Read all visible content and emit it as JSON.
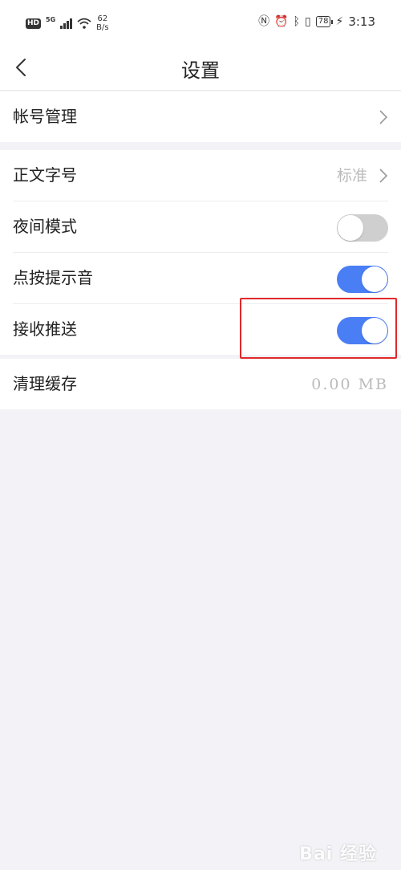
{
  "status_bar": {
    "network_badge": "HD",
    "signal_label": "5G",
    "speed_value": "62",
    "speed_unit": "B/s",
    "battery": "78",
    "time": "3:13"
  },
  "header": {
    "title": "设置"
  },
  "settings": {
    "account": {
      "label": "帐号管理"
    },
    "font_size": {
      "label": "正文字号",
      "value": "标准"
    },
    "night_mode": {
      "label": "夜间模式",
      "enabled": false
    },
    "tap_sound": {
      "label": "点按提示音",
      "enabled": true
    },
    "push": {
      "label": "接收推送",
      "enabled": true
    },
    "clear_cache": {
      "label": "清理缓存",
      "value": "0.00 MB"
    }
  },
  "colors": {
    "toggle_on": "#4a7ef5",
    "toggle_off": "#cfcfcf",
    "highlight": "#e0292b",
    "background": "#f3f3f7"
  },
  "watermark": "Bai 经验"
}
